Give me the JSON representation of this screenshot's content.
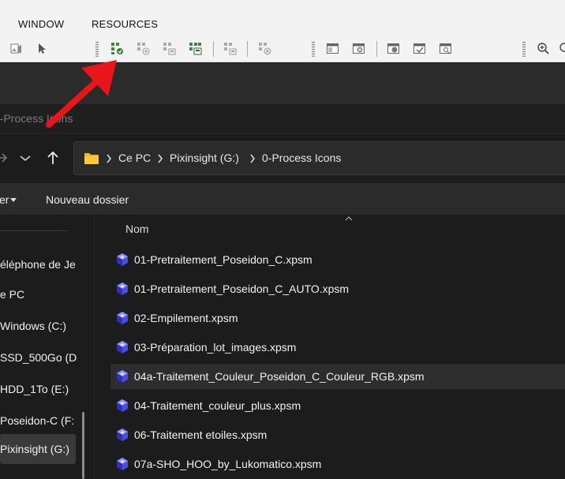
{
  "app": {
    "menu": [
      "WINDOW",
      "RESOURCES"
    ],
    "toolbar_icons": [
      "image-icon",
      "pointer-icon",
      "load-process-icons-icon",
      "add-process-icon",
      "merge-process-icons-icon",
      "save-process-icons-icon",
      "save-selected-icons-icon",
      "delete-process-icons-icon",
      "workspace-icon",
      "close-workspace-icon",
      "image-save-icon",
      "image-check-icon",
      "image-search-icon",
      "zoom-in-icon",
      "zoom-out-icon"
    ]
  },
  "explorer": {
    "window_title": "0-Process Icons",
    "address": {
      "segments": [
        "Ce PC",
        "Pixinsight (G:)",
        "0-Process Icons"
      ]
    },
    "commands": {
      "trier_label": "er",
      "new_folder_label": "Nouveau dossier"
    },
    "nav_items": [
      "éléphone de Je",
      "e PC",
      "Windows (C:)",
      "SSD_500Go (D",
      "HDD_1To (E:)",
      "Poseidon-C (F:",
      "Pixinsight (G:)"
    ],
    "selected_nav_index": 6,
    "column_header": "Nom",
    "files": [
      "01-Pretraitement_Poseidon_C.xpsm",
      "01-Pretraitement_Poseidon_C_AUTO.xpsm",
      "02-Empilement.xpsm",
      "03-Préparation_lot_images.xpsm",
      "04a-Traitement_Couleur_Poseidon_C_Couleur_RGB.xpsm",
      "04-Traitement_couleur_plus.xpsm",
      "06-Traitement etoiles.xpsm",
      "07a-SHO_HOO_by_Lukomatico.xpsm"
    ],
    "hover_file_index": 4
  },
  "colors": {
    "annotation_arrow": "#e8151b",
    "file_icon": "#4a4fe0"
  }
}
